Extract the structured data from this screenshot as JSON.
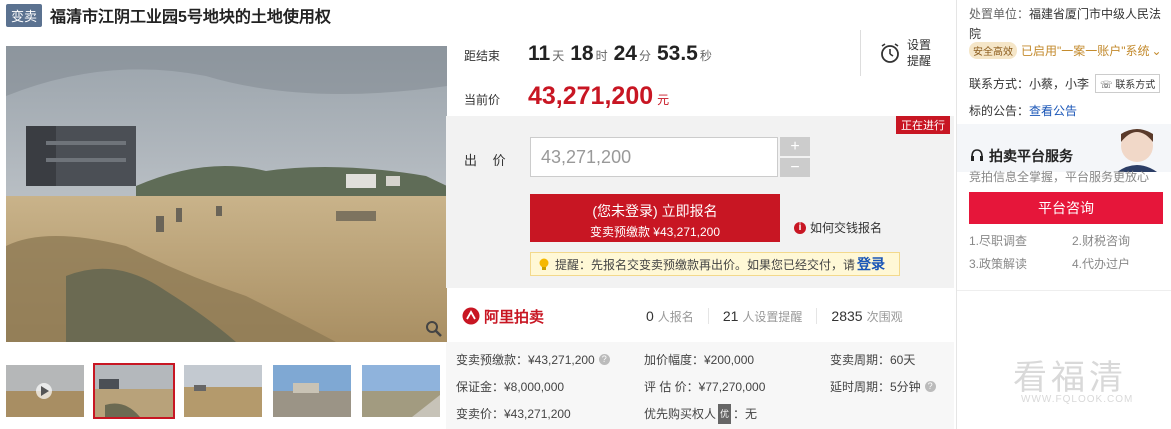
{
  "title": {
    "badge": "变卖",
    "text": "福清市江阴工业园5号地块的土地使用权"
  },
  "countdown": {
    "label": "距结束",
    "days": "11",
    "days_unit": "天",
    "hours": "18",
    "hours_unit": "时",
    "minutes": "24",
    "minutes_unit": "分",
    "seconds": "53.5",
    "seconds_unit": "秒"
  },
  "remind": {
    "label_line1": "设置",
    "label_line2": "提醒"
  },
  "current_price": {
    "label": "当前价",
    "value": "43,271,200",
    "unit": "元"
  },
  "status_tag": "正在进行",
  "bid": {
    "label": "出 价",
    "input_value": "43,271,200",
    "plus": "+",
    "minus": "−"
  },
  "signup_button": {
    "line1": "(您未登录) 立即报名",
    "line2": "变卖预缴款 ¥43,271,200"
  },
  "howto": "如何交钱报名",
  "tip": {
    "text": "提醒：先报名交变卖预缴款再出价。如果您已经交付，请",
    "login": "登录"
  },
  "platform": "阿里拍卖",
  "stats": [
    {
      "num": "0",
      "text": "人报名"
    },
    {
      "num": "21",
      "text": "人设置提醒"
    },
    {
      "num": "2835",
      "text": "次围观"
    }
  ],
  "info": {
    "col1": [
      "变卖预缴款：¥43,271,200",
      "保证金：¥8,000,000",
      "变卖价：¥43,271,200"
    ],
    "col2": [
      "加价幅度：¥200,000",
      "评 估 价：¥77,270,000",
      "优先购买权人"
    ],
    "col2_priority_badge": "优",
    "col2_priority_value": "：无",
    "col3": [
      "变卖周期：60天",
      "延时周期：5分钟"
    ]
  },
  "right": {
    "court_label": "处置单位：",
    "court_value": "福建省厦门市中级人民法院",
    "safe_badge": "安全高效",
    "safe_text": "已启用\"一案一账户\"系统",
    "safe_chevron": "⌄",
    "contact_label": "联系方式：小蔡，小李",
    "contact_button": "联系方式",
    "announce_label": "标的公告：",
    "announce_link": "查看公告",
    "service_title": "拍卖平台服务",
    "service_sub": "竞拍信息全掌握，平台服务更放心",
    "consult_button": "平台咨询",
    "service_items": [
      "1.尽职调查",
      "2.财税咨询",
      "3.政策解读",
      "4.代办过户"
    ],
    "watermark": "看福清",
    "watermark_url": "WWW.FQLOOK.COM"
  },
  "colors": {
    "accent": "#c81623",
    "link": "#1a56b7",
    "badge": "#5b7290",
    "consult": "#e6163a"
  }
}
